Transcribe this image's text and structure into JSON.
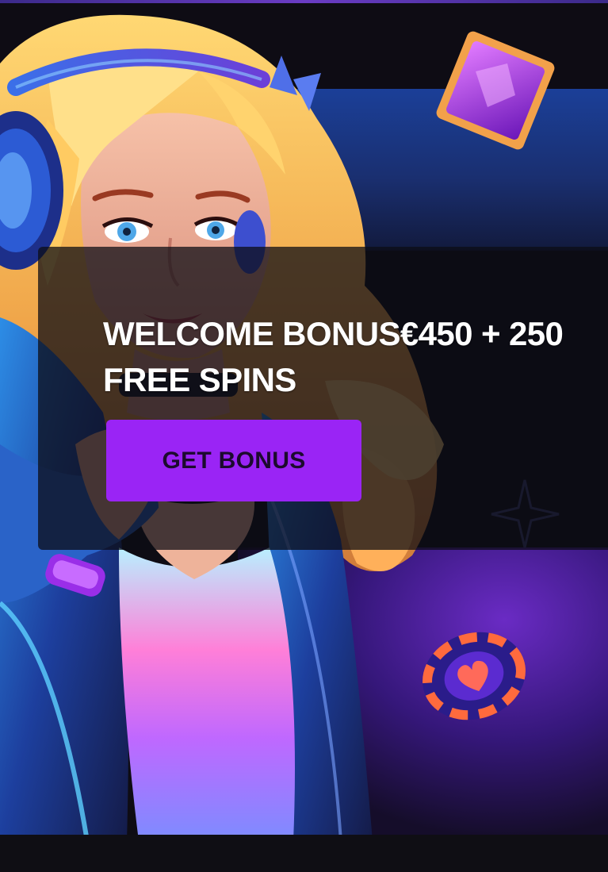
{
  "promo": {
    "headline_line1": "WELCOME BONUS€450 + 250",
    "headline_line2": "FREE SPINS",
    "cta_label": "GET BONUS"
  },
  "artwork": {
    "character": "headphones-girl-illustration",
    "icons": [
      "purple-gem-icon",
      "casino-chip-icon",
      "sparkle-icon"
    ]
  },
  "colors": {
    "cta_background": "#9a24f5",
    "cta_text": "#1c0a2e",
    "headline_text": "#ffffff",
    "page_background": "#0e0c14"
  }
}
